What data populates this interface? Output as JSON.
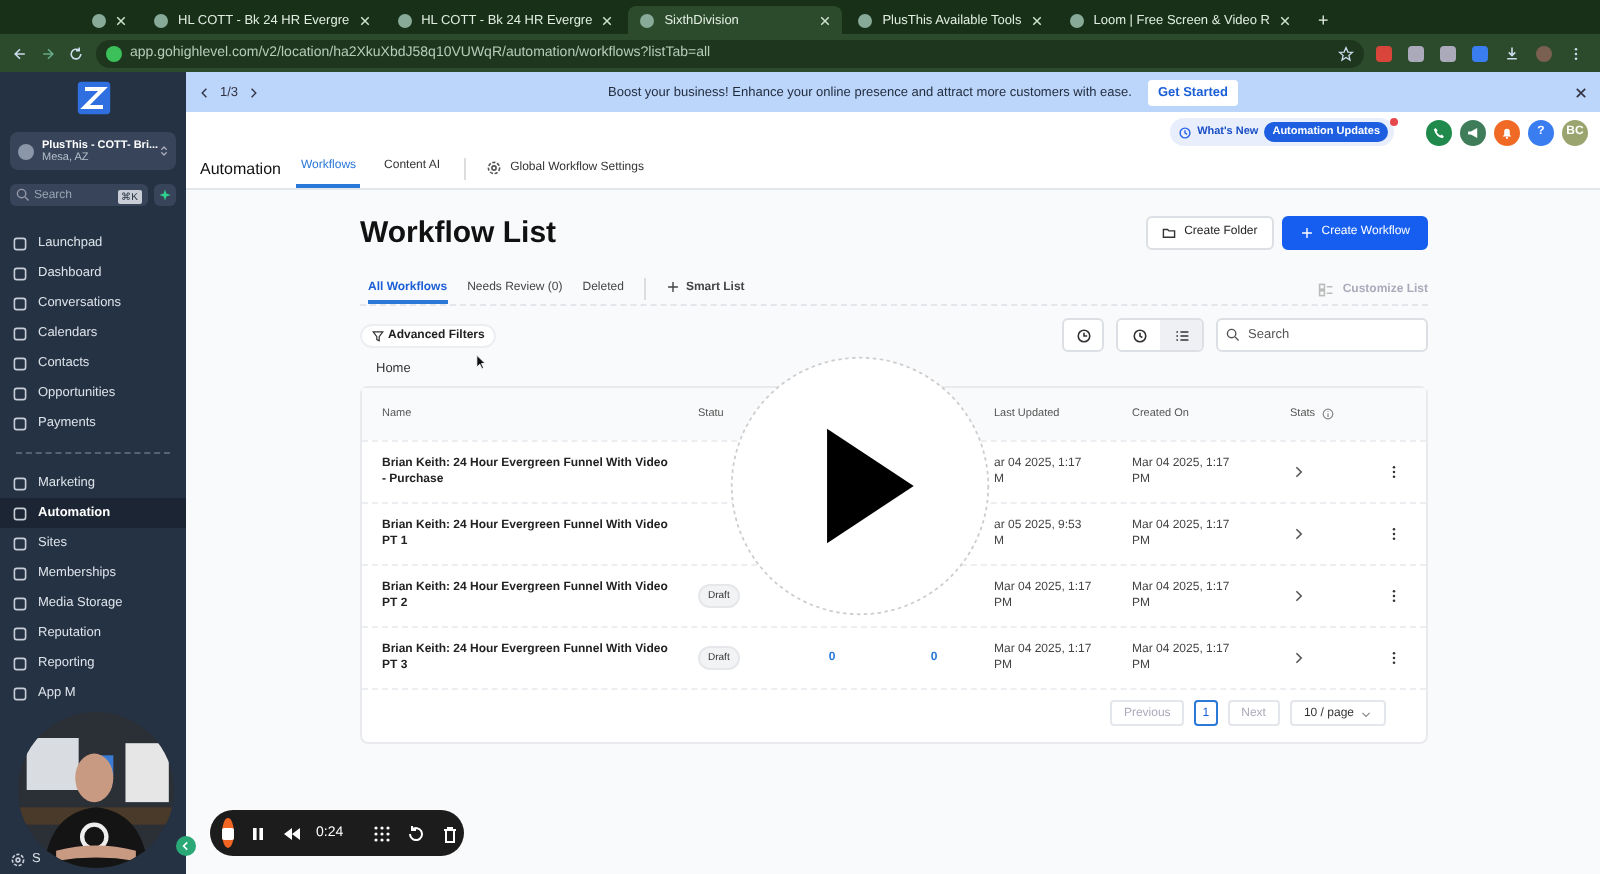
{
  "browser": {
    "tabs": [
      {
        "selected": false
      },
      {
        "title": "HL COTT - Bk 24 HR Evergre",
        "selected": false
      },
      {
        "title": "HL COTT - Bk 24 HR Evergre",
        "selected": false
      },
      {
        "title": "SixthDivision",
        "selected": true
      },
      {
        "title": "PlusThis Available Tools",
        "selected": false
      },
      {
        "title": "Loom | Free Screen & Video R",
        "selected": false
      }
    ],
    "new_tab": "+",
    "url": "app.gohighlevel.com/v2/location/ha2XkuXbdJ58q10VUWqR/automation/workflows?listTab=all"
  },
  "sidebar": {
    "account": {
      "name": "PlusThis - COTT- Bri...",
      "location": "Mesa, AZ"
    },
    "search": {
      "placeholder": "Search",
      "shortcut": "⌘K"
    },
    "primary_items": [
      {
        "label": "Launchpad",
        "selected": false
      },
      {
        "label": "Dashboard",
        "selected": false
      },
      {
        "label": "Conversations",
        "selected": false
      },
      {
        "label": "Calendars",
        "selected": false
      },
      {
        "label": "Contacts",
        "selected": false
      },
      {
        "label": "Opportunities",
        "selected": false
      },
      {
        "label": "Payments",
        "selected": false
      }
    ],
    "secondary_items": [
      {
        "label": "Marketing",
        "selected": false
      },
      {
        "label": "Automation",
        "selected": true
      },
      {
        "label": "Sites",
        "selected": false
      },
      {
        "label": "Memberships",
        "selected": false
      },
      {
        "label": "Media Storage",
        "selected": false
      },
      {
        "label": "Reputation",
        "selected": false
      },
      {
        "label": "Reporting",
        "selected": false
      },
      {
        "label": "App M",
        "selected": false
      }
    ],
    "settings_item": "S"
  },
  "banner": {
    "pager": "1/3",
    "message": "Boost your business! Enhance your online presence and attract more customers with ease.",
    "button": "Get Started"
  },
  "header": {
    "whats_new": "What's New",
    "updates_badge": "Automation Updates",
    "help": "?",
    "avatar": "BC",
    "title": "Automation",
    "nav": [
      {
        "label": "Workflows",
        "selected": true
      },
      {
        "label": "Content AI",
        "selected": false
      }
    ],
    "settings_link": "Global Workflow Settings"
  },
  "page": {
    "title": "Workflow List",
    "create_folder": "Create Folder",
    "create_workflow": "Create Workflow",
    "tabs": [
      {
        "label": "All Workflows",
        "selected": true
      },
      {
        "label": "Needs Review (0)",
        "selected": false
      },
      {
        "label": "Deleted",
        "selected": false
      }
    ],
    "smart_list": "Smart List",
    "customize_list": "Customize List",
    "advanced_filters": "Advanced Filters",
    "search": {
      "placeholder": "Search"
    },
    "breadcrumb": "Home"
  },
  "table": {
    "columns": [
      "Name",
      "Statu",
      "Last Updated",
      "Created On",
      "Stats"
    ],
    "rows": [
      {
        "name": "Brian Keith: 24 Hour Evergreen Funnel With Video - Purchase",
        "last_updated": [
          "ar 04 2025, 1:17",
          "M"
        ],
        "created_on": "Mar 04 2025, 1:17 PM"
      },
      {
        "name": "Brian Keith: 24 Hour Evergreen Funnel With Video PT 1",
        "last_updated": [
          "ar 05 2025, 9:53",
          "M"
        ],
        "created_on": "Mar 04 2025, 1:17 PM"
      },
      {
        "name": "Brian Keith: 24 Hour Evergreen Funnel With Video PT 2",
        "status": "Draft",
        "last_updated": [
          "Mar 04 2025, 1:17",
          "PM"
        ],
        "created_on": "Mar 04 2025, 1:17 PM"
      },
      {
        "name": "Brian Keith: 24 Hour Evergreen Funnel With Video PT 3",
        "status": "Draft",
        "column_3": "0",
        "column_4": "0",
        "last_updated": [
          "Mar 04 2025, 1:17",
          "PM"
        ],
        "created_on": "Mar 04 2025, 1:17 PM"
      }
    ],
    "pagination": {
      "previous": "Previous",
      "pages": [
        {
          "label": "1",
          "selected": true
        }
      ],
      "next": "Next",
      "page_size": "10 / page"
    }
  },
  "recorder": {
    "time": "0:24"
  }
}
